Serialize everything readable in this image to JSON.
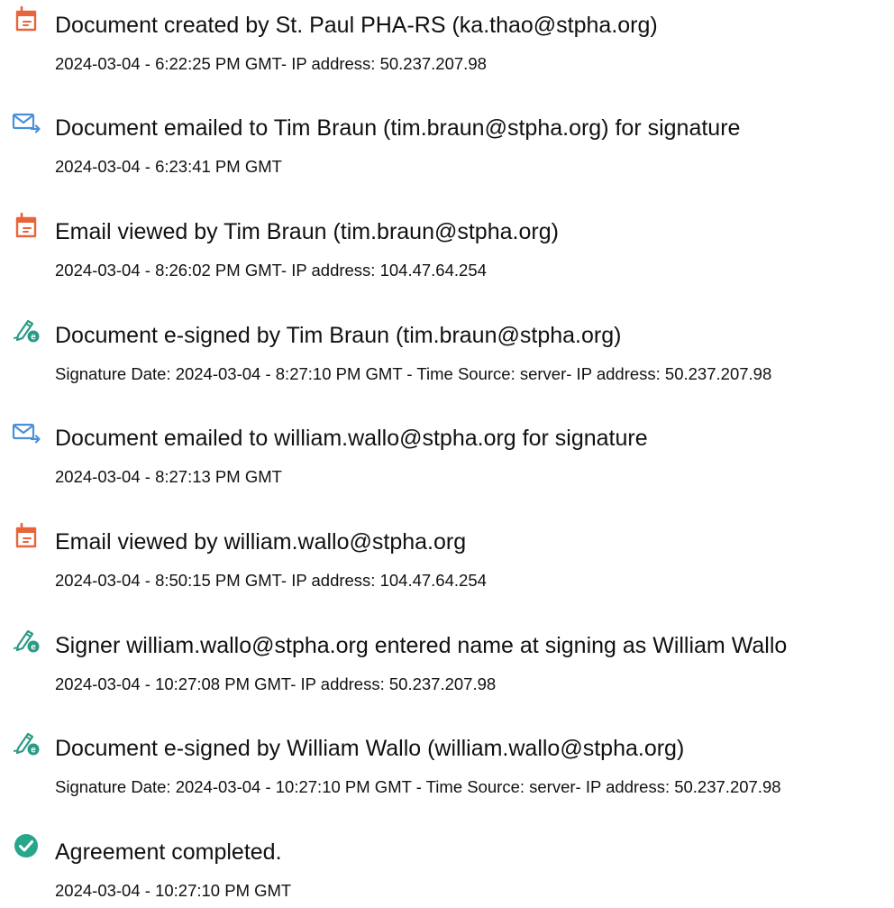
{
  "entries": [
    {
      "icon": "document-created-icon",
      "title": "Document created by St. Paul PHA-RS (ka.thao@stpha.org)",
      "detail": "2024-03-04 - 6:22:25 PM GMT- IP address: 50.237.207.98"
    },
    {
      "icon": "email-sent-icon",
      "title": "Document emailed to Tim Braun (tim.braun@stpha.org) for signature",
      "detail": "2024-03-04 - 6:23:41 PM GMT"
    },
    {
      "icon": "document-viewed-icon",
      "title": "Email viewed by Tim Braun (tim.braun@stpha.org)",
      "detail": "2024-03-04 - 8:26:02 PM GMT- IP address: 104.47.64.254"
    },
    {
      "icon": "esign-pen-icon",
      "title": "Document e-signed by Tim Braun (tim.braun@stpha.org)",
      "detail": "Signature Date: 2024-03-04 - 8:27:10 PM GMT - Time Source: server- IP address: 50.237.207.98"
    },
    {
      "icon": "email-sent-icon",
      "title": "Document emailed to william.wallo@stpha.org for signature",
      "detail": "2024-03-04 - 8:27:13 PM GMT"
    },
    {
      "icon": "document-viewed-icon",
      "title": "Email viewed by william.wallo@stpha.org",
      "detail": "2024-03-04 - 8:50:15 PM GMT- IP address: 104.47.64.254"
    },
    {
      "icon": "esign-pen-icon",
      "title": "Signer william.wallo@stpha.org entered name at signing as William Wallo",
      "detail": "2024-03-04 - 10:27:08 PM GMT- IP address: 50.237.207.98"
    },
    {
      "icon": "esign-pen-icon",
      "title": "Document e-signed by William Wallo (william.wallo@stpha.org)",
      "detail": "Signature Date: 2024-03-04 - 10:27:10 PM GMT - Time Source: server- IP address: 50.237.207.98"
    },
    {
      "icon": "completed-check-icon",
      "title": "Agreement completed.",
      "detail": "2024-03-04 - 10:27:10 PM GMT"
    }
  ],
  "colors": {
    "document_icon": "#e8643a",
    "email_icon": "#4a8fd8",
    "esign_icon": "#2c9b86",
    "completed_icon": "#28a68c",
    "text": "#111111"
  }
}
